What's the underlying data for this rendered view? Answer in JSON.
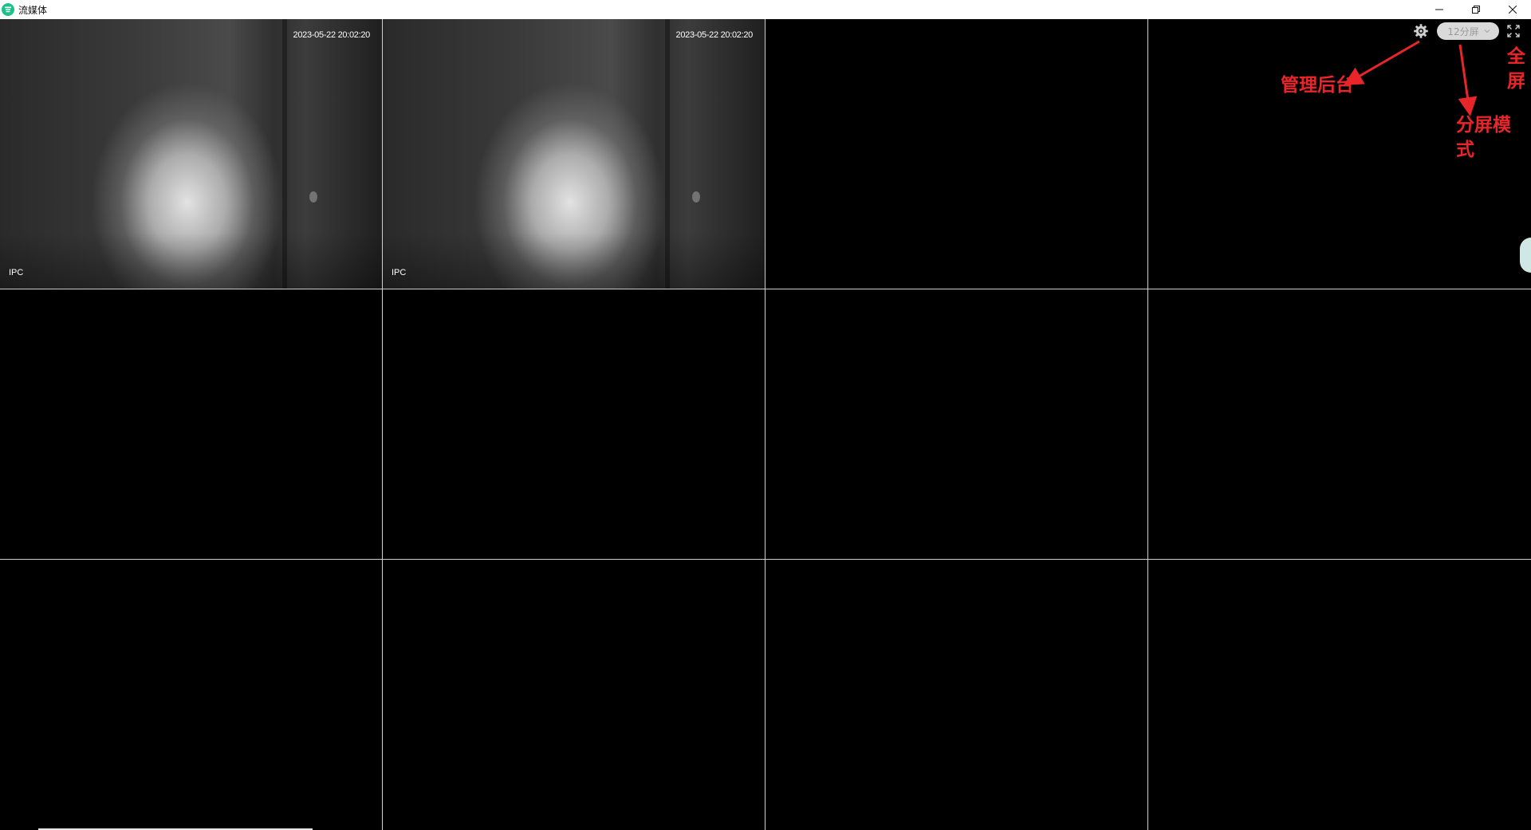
{
  "window": {
    "title": "流媒体",
    "accent_color": "#1dbf8a",
    "controls": [
      "minimize-icon",
      "restore-icon",
      "close-icon"
    ]
  },
  "toolbar": {
    "settings_icon": "gear-icon",
    "split_mode_value": "12分屏",
    "fullscreen_icon": "fullscreen-icon"
  },
  "grid": {
    "columns": 4,
    "rows": 3,
    "cells": [
      {
        "timestamp": "2023-05-22 20:02:20",
        "label": "IPC",
        "active": true
      },
      {
        "timestamp": "2023-05-22 20:02:20",
        "label": "IPC",
        "active": true
      },
      {
        "timestamp": "",
        "label": "",
        "active": false
      },
      {
        "timestamp": "",
        "label": "",
        "active": false
      },
      {
        "timestamp": "",
        "label": "",
        "active": false
      },
      {
        "timestamp": "",
        "label": "",
        "active": false
      },
      {
        "timestamp": "",
        "label": "",
        "active": false
      },
      {
        "timestamp": "",
        "label": "",
        "active": false
      },
      {
        "timestamp": "",
        "label": "",
        "active": false
      },
      {
        "timestamp": "",
        "label": "",
        "active": false
      },
      {
        "timestamp": "",
        "label": "",
        "active": false
      },
      {
        "timestamp": "",
        "label": "",
        "active": false
      }
    ]
  },
  "annotations": {
    "admin": "管理后台",
    "split_mode": "分屏模式",
    "fullscreen": "全屏",
    "color": "#e8262a"
  }
}
